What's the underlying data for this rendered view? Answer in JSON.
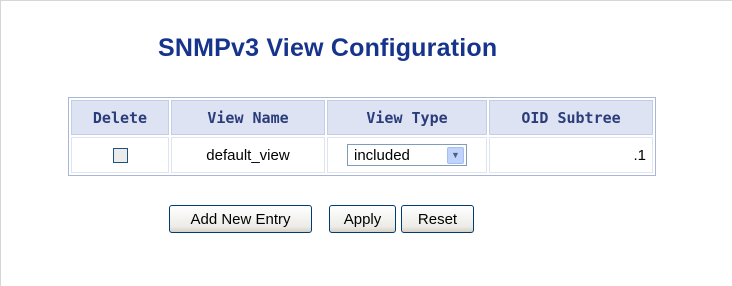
{
  "page": {
    "title": "SNMPv3 View Configuration"
  },
  "table": {
    "headers": [
      "Delete",
      "View Name",
      "View Type",
      "OID Subtree"
    ],
    "rows": [
      {
        "delete_checked": false,
        "view_name": "default_view",
        "view_type": "included",
        "oid_subtree": ".1"
      }
    ]
  },
  "buttons": {
    "add_new_entry": "Add New Entry",
    "apply": "Apply",
    "reset": "Reset"
  },
  "colors": {
    "title": "#17348c",
    "header_bg": "#dde3f3",
    "header_text": "#2b3c7a"
  },
  "icons": {
    "select_arrow": "chevron-down-icon"
  }
}
